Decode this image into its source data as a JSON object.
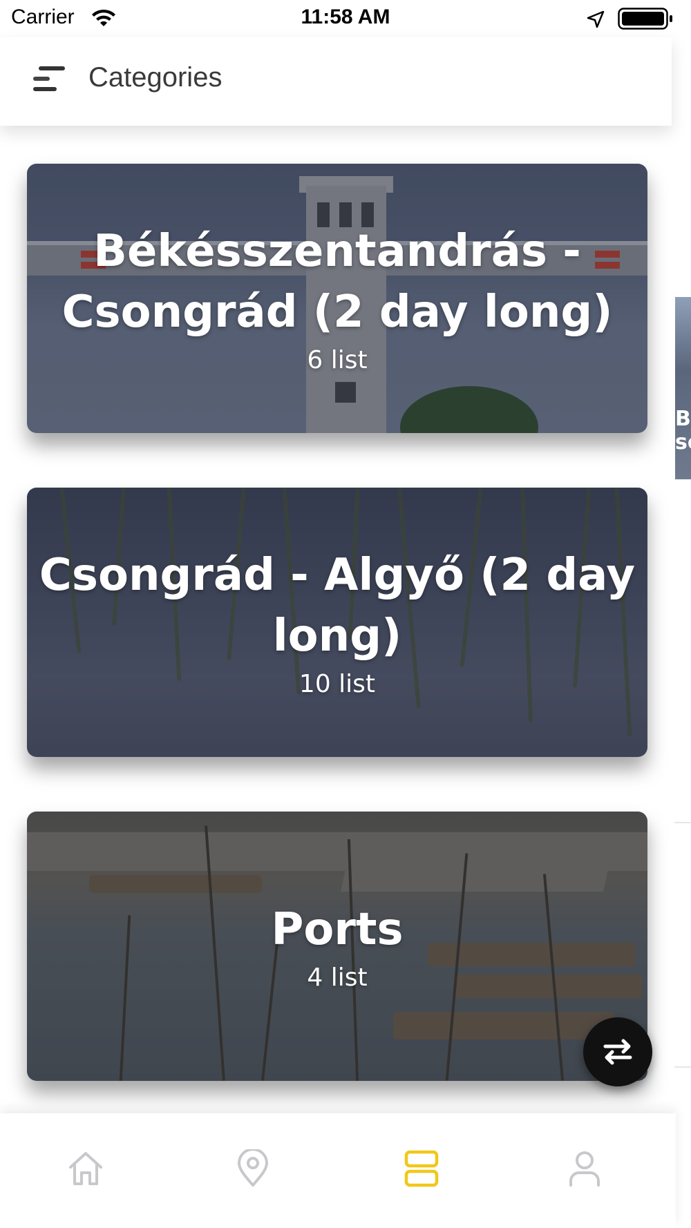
{
  "status_bar": {
    "carrier": "Carrier",
    "time": "11:58 AM"
  },
  "header": {
    "title": "Categories",
    "menu_icon": "menu-icon"
  },
  "categories": [
    {
      "title": "Békésszentandrás - Csongrád (2 day long)",
      "count": "6 list"
    },
    {
      "title": "Csongrád - Algyő (2 day long)",
      "count": "10 list"
    },
    {
      "title": "Ports",
      "count": "4 list"
    }
  ],
  "side_peek": {
    "text_line1": "Be",
    "text_line2": "sc"
  },
  "fab": {
    "icon": "swap-arrows-icon"
  },
  "bottom_nav": {
    "items": [
      {
        "icon": "home-icon",
        "active": false
      },
      {
        "icon": "map-pin-icon",
        "active": false
      },
      {
        "icon": "categories-icon",
        "active": true
      },
      {
        "icon": "profile-icon",
        "active": false
      }
    ]
  },
  "colors": {
    "accent": "#F2C718",
    "nav_inactive": "#C8C8CC",
    "fab_bg": "#111111"
  }
}
